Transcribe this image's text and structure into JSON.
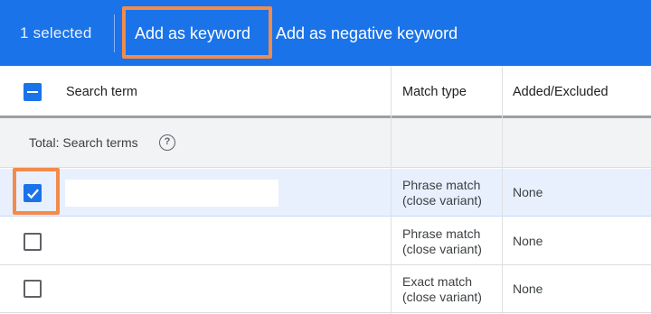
{
  "action_bar": {
    "selected_count": "1 selected",
    "add_keyword": "Add as keyword",
    "add_negative": "Add as negative keyword"
  },
  "table": {
    "headers": {
      "search_term": "Search term",
      "match_type": "Match type",
      "added_excluded": "Added/Excluded"
    },
    "total_label": "Total: Search terms",
    "help_glyph": "?",
    "rows": [
      {
        "checked": true,
        "match_line1": "Phrase match",
        "match_line2": "(close variant)",
        "status": "None"
      },
      {
        "checked": false,
        "match_line1": "Phrase match",
        "match_line2": "(close variant)",
        "status": "None"
      },
      {
        "checked": false,
        "match_line1": "Exact match",
        "match_line2": "(close variant)",
        "status": "None"
      }
    ]
  },
  "colors": {
    "accent": "#1a73e8",
    "highlight": "#f28b4b",
    "selected_row": "#e8f0fe"
  },
  "icons": {
    "help": "help-circle-icon",
    "check": "checkmark-icon",
    "indeterminate": "minus-icon"
  }
}
